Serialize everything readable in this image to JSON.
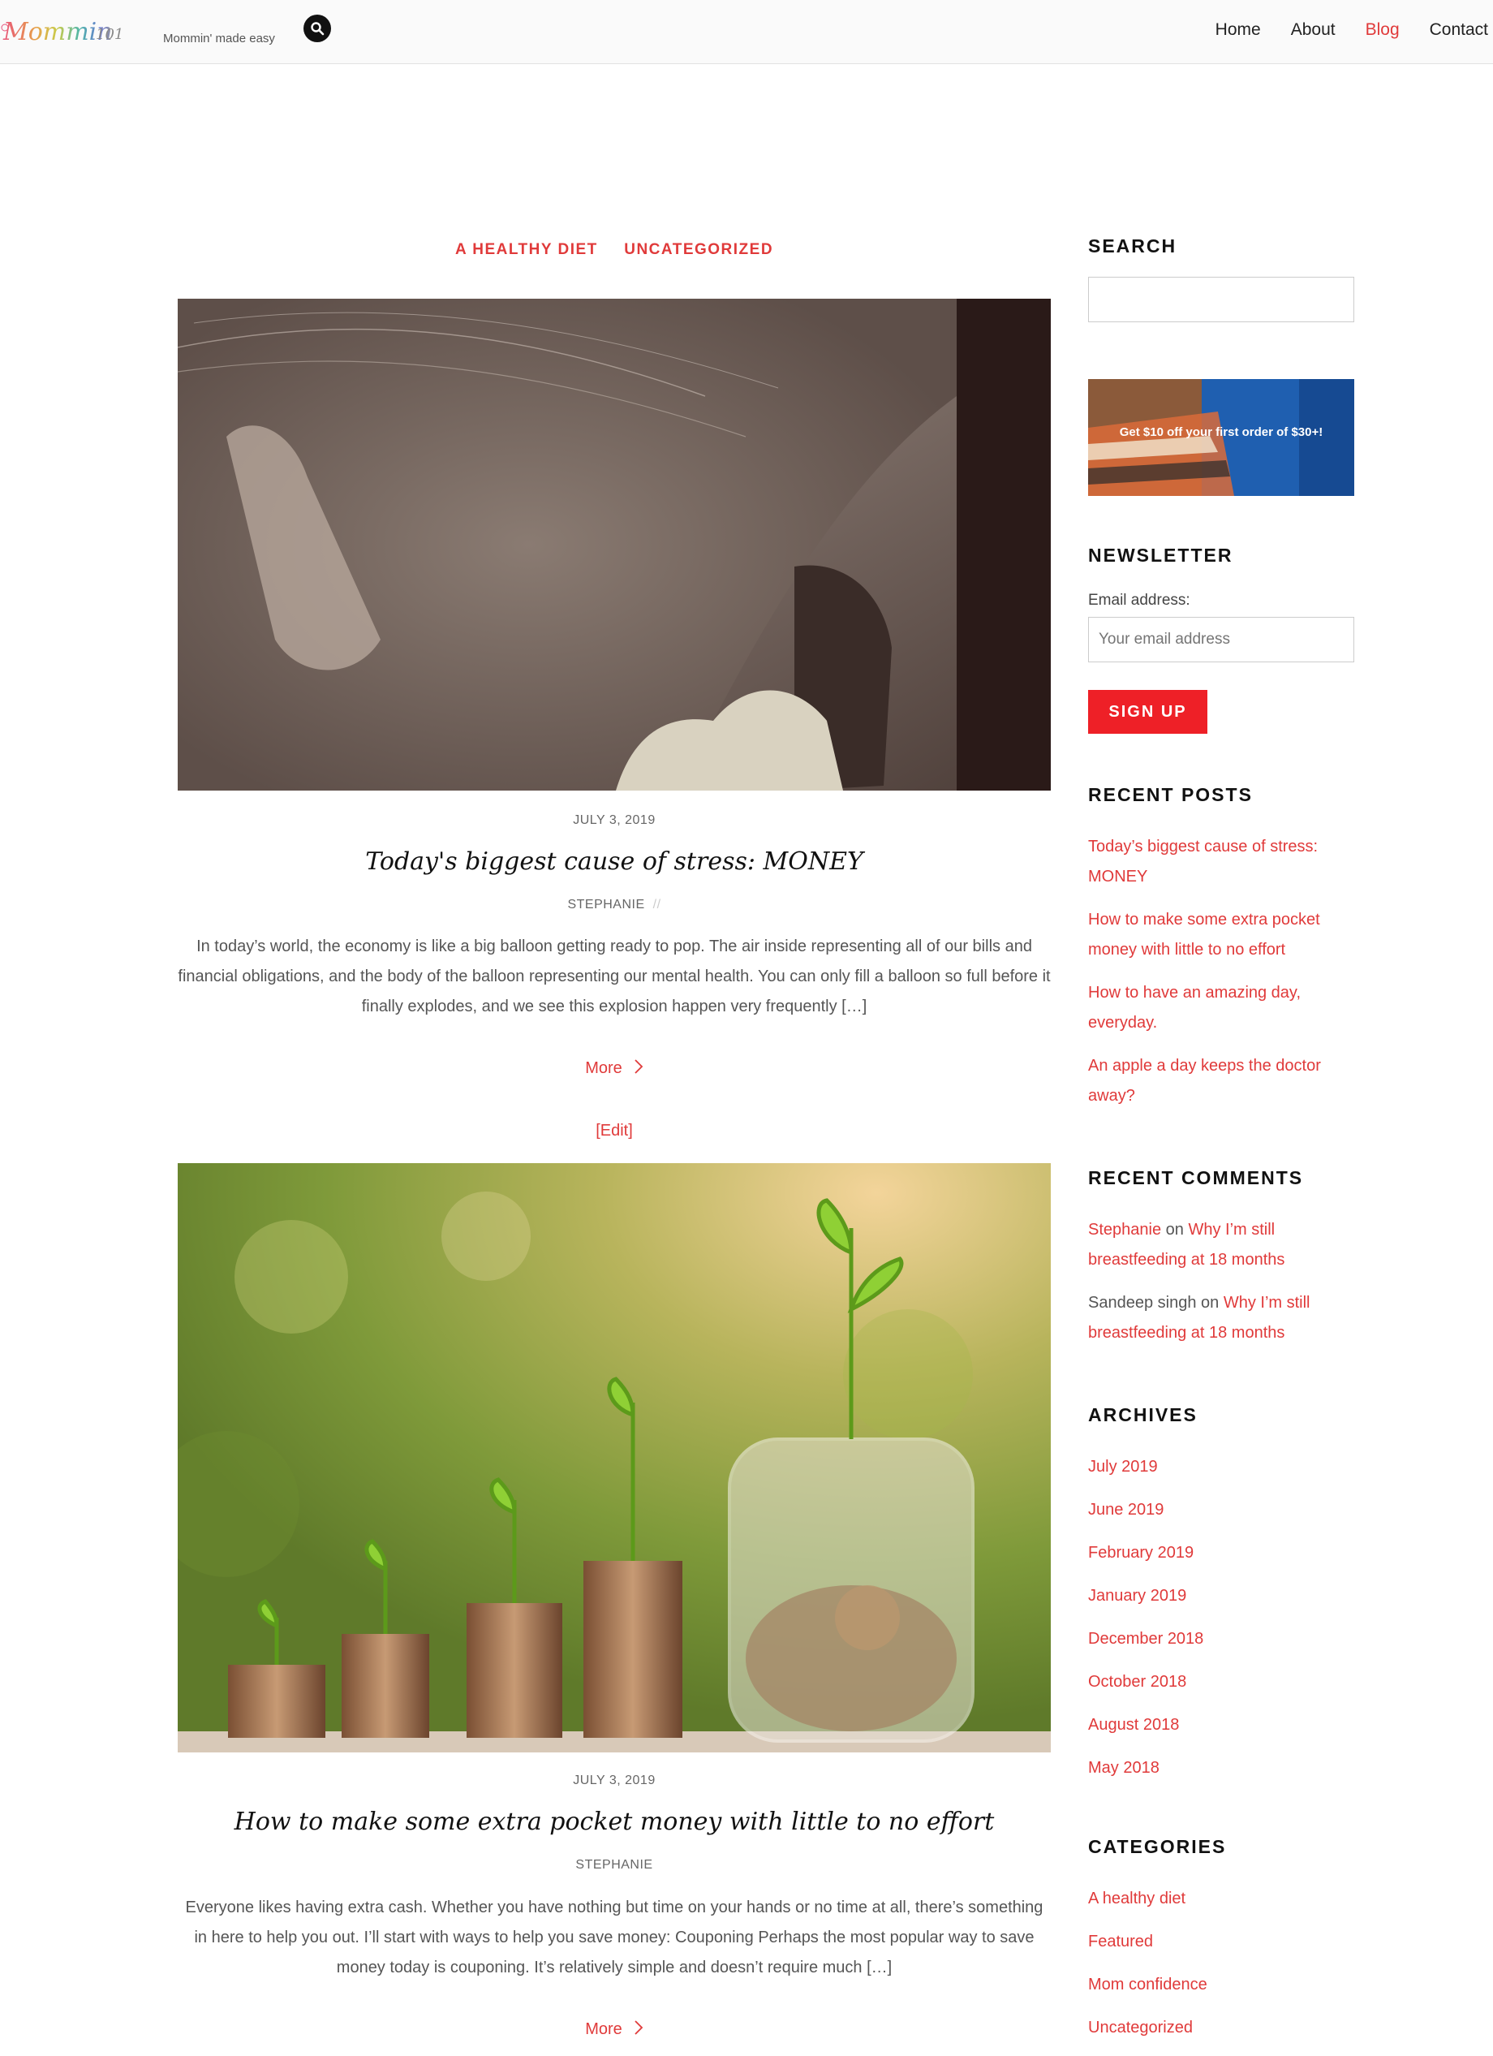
{
  "header": {
    "logo_text": "Mommin101",
    "tagline": "Mommin' made easy",
    "search_icon": "search-icon",
    "nav": [
      {
        "label": "Home",
        "active": false
      },
      {
        "label": "About",
        "active": false
      },
      {
        "label": "Blog",
        "active": true
      },
      {
        "label": "Contact",
        "active": false
      }
    ]
  },
  "main": {
    "categories": [
      "A HEALTHY DIET",
      "UNCATEGORIZED"
    ],
    "posts": [
      {
        "date": "JULY 3, 2019",
        "title": "Today's biggest cause of stress: MONEY",
        "author": "STEPHANIE",
        "excerpt": "In today’s world, the economy is like a big balloon getting ready to pop. The air inside representing all of our bills and financial obligations, and the body of the balloon representing our mental health. You can only fill a balloon so full before it finally explodes, and we see this explosion happen very frequently […]",
        "more": "More",
        "edit": "[Edit]"
      },
      {
        "date": "JULY 3, 2019",
        "title": "How to make some extra pocket money with little to no effort",
        "author": "STEPHANIE",
        "excerpt": "Everyone likes having extra cash. Whether you have nothing but time on your hands or no time at all, there’s something in here to help you out. I’ll start with ways to help you save money: Couponing Perhaps the most popular way to save money today is couponing. It’s relatively simple and doesn’t require much […]",
        "more": "More"
      }
    ]
  },
  "sidebar": {
    "search_title": "SEARCH",
    "ad_text": "Get $10 off your first order of $30+!",
    "newsletter_title": "NEWSLETTER",
    "email_label": "Email address:",
    "email_placeholder": "Your email address",
    "signup_label": "SIGN UP",
    "recent_posts_title": "RECENT POSTS",
    "recent_posts": [
      "Today’s biggest cause of stress: MONEY",
      "How to make some extra pocket money with little to no effort",
      "How to have an amazing day, everyday.",
      "An apple a day keeps the doctor away?"
    ],
    "recent_comments_title": "RECENT COMMENTS",
    "recent_comments": [
      {
        "author": "Stephanie",
        "on": "on",
        "post": "Why I’m still breastfeeding at 18 months"
      },
      {
        "author": "Sandeep singh",
        "on": "on",
        "post": "Why I’m still breastfeeding at 18 months"
      }
    ],
    "archives_title": "ARCHIVES",
    "archives": [
      "July 2019",
      "June 2019",
      "February 2019",
      "January 2019",
      "December 2018",
      "October 2018",
      "August 2018",
      "May 2018"
    ],
    "categories_title": "CATEGORIES",
    "categories": [
      "A healthy diet",
      "Featured",
      "Mom confidence",
      "Uncategorized"
    ]
  },
  "colors": {
    "accent": "#e03a3a",
    "button": "#ee2027",
    "header_bg": "#fafafa"
  }
}
